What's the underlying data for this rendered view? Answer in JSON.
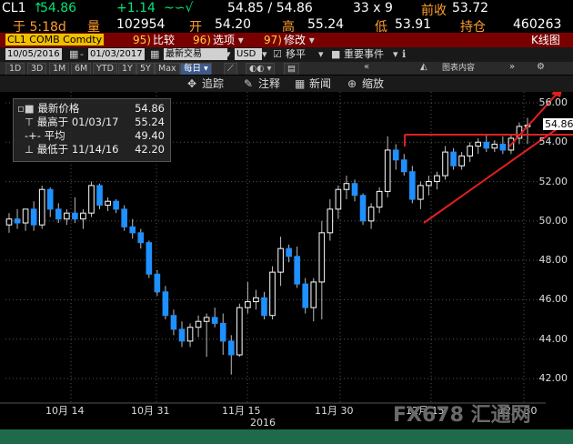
{
  "quote": {
    "ticker": "CL1",
    "last_arrow": "↑",
    "last": "54.86",
    "change": "+1.14",
    "bid_ask": "54.85 / 54.86",
    "size": "33 x 9",
    "prev_label": "前收",
    "prev": "53.72",
    "time_label": "于 5:18d",
    "vol_label": "量",
    "vol": "102954",
    "open_label": "开",
    "open": "54.20",
    "high_label": "高",
    "high": "55.24",
    "low_label": "低",
    "low": "53.91",
    "oi_label": "持仓",
    "oi": "460263"
  },
  "menu": {
    "security": "CL1 COMB Comdty",
    "items": [
      {
        "num": "95)",
        "label": "比较"
      },
      {
        "num": "96)",
        "label": "选项"
      },
      {
        "num": "97)",
        "label": "修改"
      }
    ],
    "right": "K线图"
  },
  "options": {
    "start_date": "10/05/2016",
    "end_date": "01/03/2017",
    "mode": "最新交易",
    "currency": "USD",
    "smooth": "移平",
    "events": "重要事件"
  },
  "toolbar": {
    "periods": [
      "1D",
      "3D",
      "1M",
      "6M",
      "YTD",
      "1Y",
      "5Y",
      "Max"
    ],
    "frequency": "每日",
    "chart_content": "图表内容"
  },
  "subtools": [
    "追踪",
    "注释",
    "新闻",
    "缩放"
  ],
  "legend": {
    "items": [
      {
        "label": "最新价格",
        "value": "54.86"
      },
      {
        "label": "最高于 01/03/17",
        "value": "55.24"
      },
      {
        "label": "平均",
        "value": "49.40"
      },
      {
        "label": "最低于 11/14/16",
        "value": "42.20"
      }
    ]
  },
  "last_price_tag": "54.86",
  "watermark": "FX678 汇通网",
  "chart_data": {
    "type": "candlestick",
    "ylim": [
      41.0,
      57.0
    ],
    "y_ticks": [
      "56.00",
      "54.00",
      "52.00",
      "50.00",
      "48.00",
      "46.00",
      "44.00",
      "42.00"
    ],
    "x_ticks": [
      "10月 14",
      "10月 31",
      "11月 15",
      "11月 30",
      "12月 15",
      "12月 30"
    ],
    "x_year": "2016",
    "candles": [
      {
        "o": 49.8,
        "h": 50.4,
        "l": 49.4,
        "c": 50.1
      },
      {
        "o": 50.1,
        "h": 50.6,
        "l": 49.6,
        "c": 49.9
      },
      {
        "o": 49.9,
        "h": 50.6,
        "l": 49.5,
        "c": 50.6
      },
      {
        "o": 50.6,
        "h": 51.0,
        "l": 49.5,
        "c": 49.8
      },
      {
        "o": 49.8,
        "h": 51.8,
        "l": 49.6,
        "c": 51.6
      },
      {
        "o": 51.6,
        "h": 51.7,
        "l": 50.2,
        "c": 50.6
      },
      {
        "o": 50.6,
        "h": 50.9,
        "l": 49.9,
        "c": 50.1
      },
      {
        "o": 50.1,
        "h": 50.6,
        "l": 49.8,
        "c": 50.4
      },
      {
        "o": 50.4,
        "h": 51.2,
        "l": 49.9,
        "c": 50.1
      },
      {
        "o": 50.1,
        "h": 50.6,
        "l": 49.6,
        "c": 50.4
      },
      {
        "o": 50.4,
        "h": 52.0,
        "l": 50.2,
        "c": 51.8
      },
      {
        "o": 51.8,
        "h": 51.9,
        "l": 50.6,
        "c": 50.8
      },
      {
        "o": 50.8,
        "h": 51.2,
        "l": 50.5,
        "c": 51.0
      },
      {
        "o": 51.0,
        "h": 51.1,
        "l": 50.4,
        "c": 50.6
      },
      {
        "o": 50.6,
        "h": 50.8,
        "l": 49.5,
        "c": 49.7
      },
      {
        "o": 49.7,
        "h": 50.1,
        "l": 49.1,
        "c": 49.4
      },
      {
        "o": 49.4,
        "h": 49.6,
        "l": 48.6,
        "c": 48.9
      },
      {
        "o": 48.9,
        "h": 49.0,
        "l": 47.1,
        "c": 47.3
      },
      {
        "o": 47.3,
        "h": 47.5,
        "l": 46.2,
        "c": 46.4
      },
      {
        "o": 46.4,
        "h": 46.7,
        "l": 45.0,
        "c": 45.2
      },
      {
        "o": 45.2,
        "h": 45.5,
        "l": 44.2,
        "c": 44.5
      },
      {
        "o": 44.5,
        "h": 44.9,
        "l": 43.6,
        "c": 43.9
      },
      {
        "o": 43.9,
        "h": 44.8,
        "l": 43.6,
        "c": 44.6
      },
      {
        "o": 44.6,
        "h": 45.2,
        "l": 44.1,
        "c": 44.9
      },
      {
        "o": 44.9,
        "h": 45.3,
        "l": 43.1,
        "c": 45.1
      },
      {
        "o": 45.1,
        "h": 45.6,
        "l": 44.6,
        "c": 44.8
      },
      {
        "o": 44.8,
        "h": 45.3,
        "l": 43.2,
        "c": 43.9
      },
      {
        "o": 43.9,
        "h": 44.2,
        "l": 42.2,
        "c": 43.2
      },
      {
        "o": 43.2,
        "h": 45.8,
        "l": 43.1,
        "c": 45.6
      },
      {
        "o": 45.6,
        "h": 46.9,
        "l": 45.3,
        "c": 45.9
      },
      {
        "o": 45.9,
        "h": 46.5,
        "l": 45.5,
        "c": 46.1
      },
      {
        "o": 46.1,
        "h": 46.4,
        "l": 45.0,
        "c": 45.2
      },
      {
        "o": 45.2,
        "h": 47.7,
        "l": 45.0,
        "c": 47.4
      },
      {
        "o": 47.4,
        "h": 49.2,
        "l": 46.7,
        "c": 48.6
      },
      {
        "o": 48.6,
        "h": 48.8,
        "l": 47.9,
        "c": 48.2
      },
      {
        "o": 48.2,
        "h": 48.7,
        "l": 46.6,
        "c": 46.8
      },
      {
        "o": 46.8,
        "h": 47.1,
        "l": 45.3,
        "c": 45.6
      },
      {
        "o": 45.6,
        "h": 47.1,
        "l": 44.9,
        "c": 46.9
      },
      {
        "o": 46.9,
        "h": 50.0,
        "l": 45.0,
        "c": 49.4
      },
      {
        "o": 49.4,
        "h": 51.1,
        "l": 49.0,
        "c": 50.6
      },
      {
        "o": 50.6,
        "h": 51.8,
        "l": 50.1,
        "c": 51.6
      },
      {
        "o": 51.6,
        "h": 52.3,
        "l": 51.1,
        "c": 51.9
      },
      {
        "o": 51.9,
        "h": 52.1,
        "l": 51.0,
        "c": 51.3
      },
      {
        "o": 51.3,
        "h": 51.4,
        "l": 49.8,
        "c": 50.0
      },
      {
        "o": 50.0,
        "h": 50.9,
        "l": 49.6,
        "c": 50.7
      },
      {
        "o": 50.7,
        "h": 51.7,
        "l": 50.4,
        "c": 51.5
      },
      {
        "o": 51.5,
        "h": 54.3,
        "l": 51.2,
        "c": 53.6
      },
      {
        "o": 53.6,
        "h": 53.9,
        "l": 52.6,
        "c": 53.1
      },
      {
        "o": 53.1,
        "h": 53.4,
        "l": 52.3,
        "c": 52.5
      },
      {
        "o": 52.5,
        "h": 52.8,
        "l": 50.9,
        "c": 51.1
      },
      {
        "o": 51.1,
        "h": 52.0,
        "l": 50.6,
        "c": 51.8
      },
      {
        "o": 51.8,
        "h": 52.3,
        "l": 51.3,
        "c": 52.0
      },
      {
        "o": 52.0,
        "h": 52.5,
        "l": 51.6,
        "c": 52.3
      },
      {
        "o": 52.3,
        "h": 53.8,
        "l": 52.1,
        "c": 53.5
      },
      {
        "o": 53.5,
        "h": 53.7,
        "l": 52.6,
        "c": 52.8
      },
      {
        "o": 52.8,
        "h": 53.5,
        "l": 52.6,
        "c": 53.3
      },
      {
        "o": 53.3,
        "h": 54.0,
        "l": 53.0,
        "c": 53.8
      },
      {
        "o": 53.8,
        "h": 54.2,
        "l": 53.4,
        "c": 54.0
      },
      {
        "o": 54.0,
        "h": 54.4,
        "l": 53.5,
        "c": 53.7
      },
      {
        "o": 53.7,
        "h": 54.1,
        "l": 53.5,
        "c": 53.9
      },
      {
        "o": 53.9,
        "h": 54.3,
        "l": 53.4,
        "c": 53.6
      },
      {
        "o": 53.6,
        "h": 54.4,
        "l": 53.4,
        "c": 54.2
      },
      {
        "o": 54.2,
        "h": 55.0,
        "l": 53.9,
        "c": 54.8
      },
      {
        "o": 54.8,
        "h": 55.24,
        "l": 53.91,
        "c": 54.86
      }
    ]
  }
}
